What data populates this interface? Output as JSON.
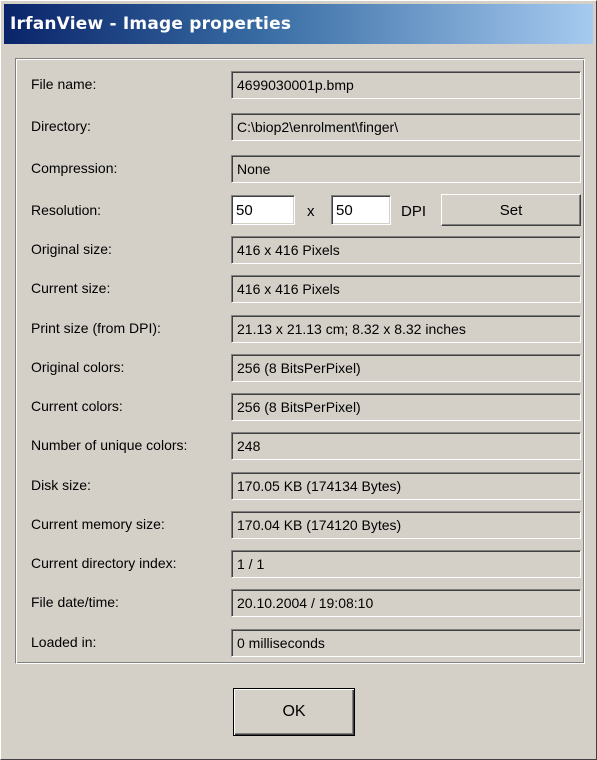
{
  "window": {
    "title": "IrfanView - Image properties"
  },
  "properties": [
    {
      "label": "File name:",
      "value": "4699030001p.bmp"
    },
    {
      "label": "Directory:",
      "value": "C:\\biop2\\enrolment\\finger\\"
    },
    {
      "label": "Compression:",
      "value": "None"
    },
    {
      "label": "Resolution:",
      "value": ""
    },
    {
      "label": "Original size:",
      "value": "416 x 416  Pixels"
    },
    {
      "label": "Current size:",
      "value": "416 x 416  Pixels"
    },
    {
      "label": "Print size (from DPI):",
      "value": "21.13 x 21.13 cm; 8.32 x 8.32 inches"
    },
    {
      "label": "Original colors:",
      "value": "256  (8 BitsPerPixel)"
    },
    {
      "label": "Current colors:",
      "value": "256  (8 BitsPerPixel)"
    },
    {
      "label": "Number of unique colors:",
      "value": "248"
    },
    {
      "label": "Disk size:",
      "value": "170.05  KB (174134 Bytes)"
    },
    {
      "label": "Current memory size:",
      "value": "170.04  KB (174120 Bytes)"
    },
    {
      "label": "Current directory index:",
      "value": "1  /  1"
    },
    {
      "label": "File date/time:",
      "value": "20.10.2004 / 19:08:10"
    },
    {
      "label": "Loaded in:",
      "value": "0 milliseconds"
    }
  ],
  "resolution": {
    "dpi_x": "50",
    "separator": "x",
    "dpi_y": "50",
    "unit": "DPI",
    "set_label": "Set"
  },
  "buttons": {
    "ok_label": "OK"
  },
  "colors": {
    "dialog_face": "#d4d0c8",
    "title_active": "#0a246a",
    "title_gradient_end": "#a6caf0"
  }
}
